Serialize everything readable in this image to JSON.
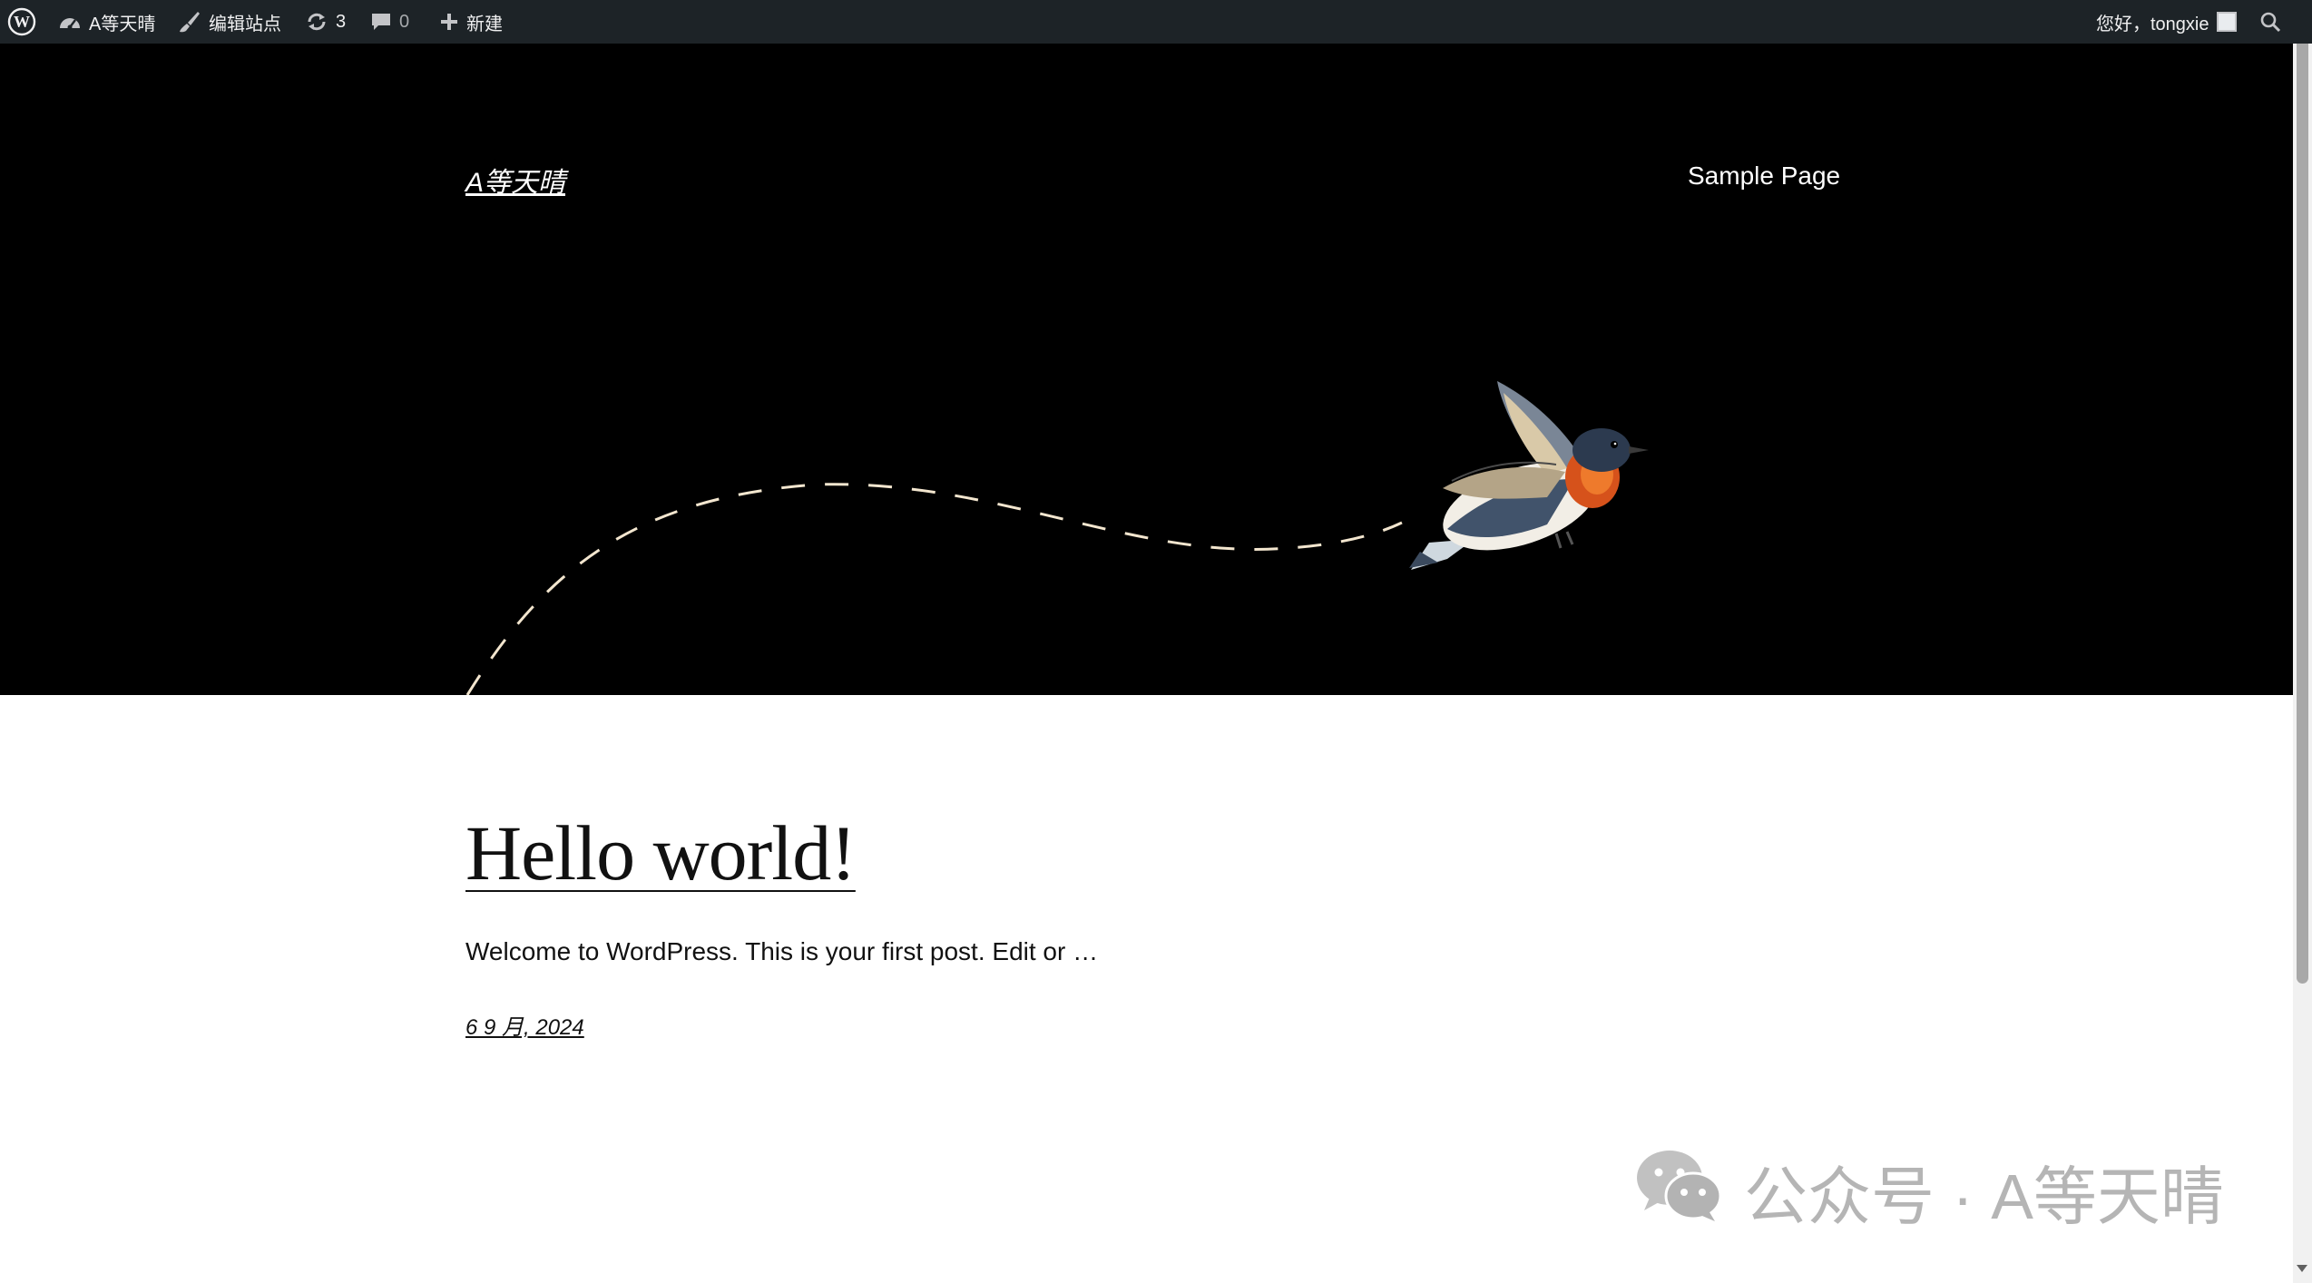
{
  "admin_bar": {
    "site_name": "A等天晴",
    "edit_site": "编辑站点",
    "updates_count": "3",
    "comments_count": "0",
    "new_label": "新建",
    "greeting": "您好，tongxie"
  },
  "header": {
    "site_title": "A等天晴",
    "nav": [
      "Sample Page"
    ]
  },
  "post": {
    "title": "Hello world!",
    "excerpt": "Welcome to WordPress. This is your first post. Edit or …",
    "date": "6 9 月, 2024"
  },
  "watermark": {
    "text": "公众号 · A等天晴"
  },
  "colors": {
    "admin_bar_bg": "#1d2327",
    "hero_bg": "#000000",
    "page_bg": "#ffffff",
    "text": "#111111"
  },
  "icons": {
    "wordpress": "wordpress-logo-icon",
    "dashboard": "dashboard-icon",
    "edit": "brush-icon",
    "updates": "refresh-icon",
    "comments": "comment-icon",
    "new": "plus-icon",
    "search": "search-icon",
    "watermark": "wechat-icon"
  }
}
